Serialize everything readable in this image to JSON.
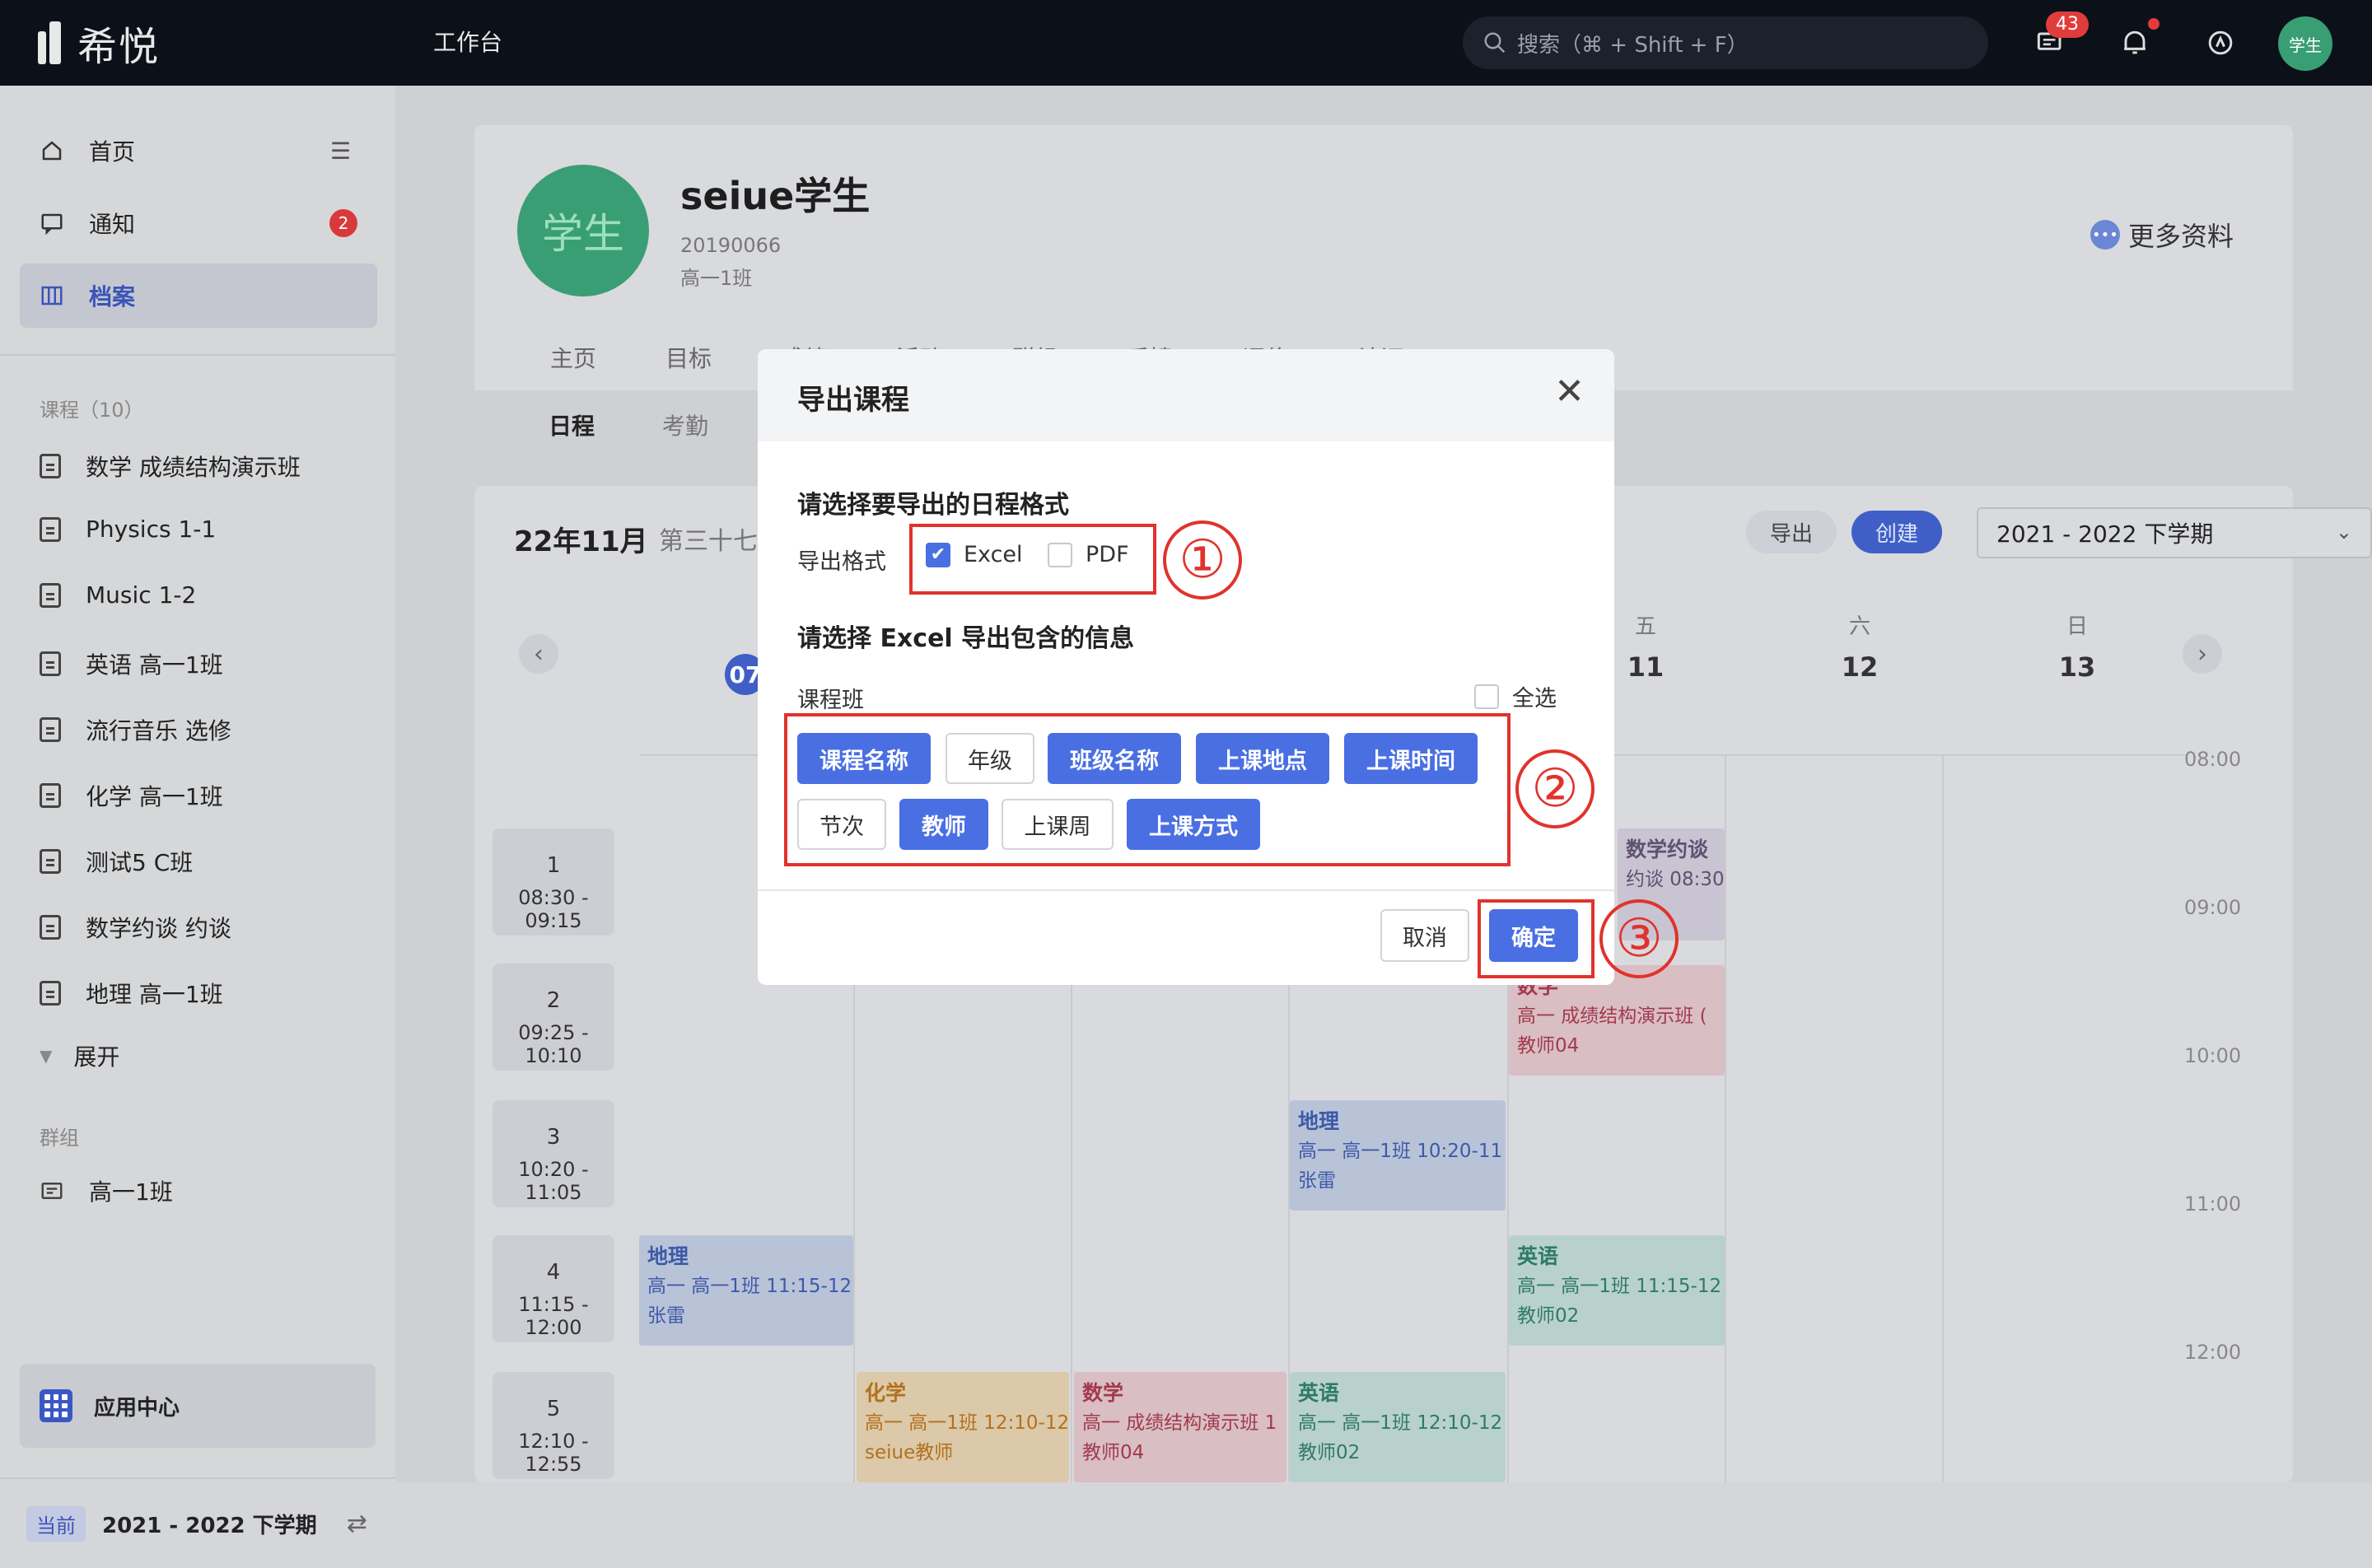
{
  "topbar": {
    "logo_text": "希悦",
    "workbench": "工作台",
    "search_placeholder": "搜索（⌘ + Shift + F）",
    "message_count": "43",
    "avatar_text": "学生"
  },
  "sidebar": {
    "nav": [
      {
        "label": "首页",
        "icon": "home-icon"
      },
      {
        "label": "通知",
        "icon": "message-icon",
        "badge": "2"
      },
      {
        "label": "档案",
        "icon": "archive-icon",
        "active": true
      }
    ],
    "courses_title": "课程（10）",
    "courses": [
      "数学 成绩结构演示班",
      "Physics 1-1",
      "Music 1-2",
      "英语 高一1班",
      "流行音乐 选修",
      "化学 高一1班",
      "测试5 C班",
      "数学约谈 约谈",
      "地理 高一1班"
    ],
    "expand_label": "展开",
    "groups_title": "群组",
    "groups": [
      "高一1班"
    ],
    "app_center": "应用中心",
    "term_tag": "当前",
    "term": "2021 - 2022 下学期"
  },
  "profile": {
    "avatar_text": "学生",
    "name": "seiue学生",
    "id": "20190066",
    "class": "高一1班",
    "more_info": "更多资料",
    "tabs": [
      "主页",
      "目标",
      "成绩",
      "活动",
      "群组",
      "反馈",
      "评价",
      "认证"
    ],
    "subtabs": [
      "日程",
      "考勤"
    ]
  },
  "calendar": {
    "month": "22年11月",
    "week": "第三十七",
    "export": "导出",
    "create": "创建",
    "term_select": "2021 - 2022 下学期",
    "today": "07",
    "days": [
      {
        "wd": "五",
        "dn": "11"
      },
      {
        "wd": "六",
        "dn": "12"
      },
      {
        "wd": "日",
        "dn": "13"
      }
    ],
    "periods": [
      {
        "n": "1",
        "t": "08:30 - 09:15"
      },
      {
        "n": "2",
        "t": "09:25 - 10:10"
      },
      {
        "n": "3",
        "t": "10:20 - 11:05"
      },
      {
        "n": "4",
        "t": "11:15 - 12:00"
      },
      {
        "n": "5",
        "t": "12:10 - 12:55"
      }
    ],
    "times": [
      "08:00",
      "09:00",
      "10:00",
      "11:00",
      "12:00"
    ],
    "events": [
      {
        "title": "数学约谈",
        "l1": "约谈  08:30",
        "l2": ""
      },
      {
        "title": "数学",
        "l1": "高一  成绩结构演示班  (",
        "l2": "教师04"
      },
      {
        "title": "地理",
        "l1": "高一  高一1班  10:20-11",
        "l2": "张雷"
      },
      {
        "title": "地理",
        "l1": "高一  高一1班  11:15-12",
        "l2": "张雷"
      },
      {
        "title": "英语",
        "l1": "高一  高一1班  11:15-12",
        "l2": "教师02"
      },
      {
        "title": "化学",
        "l1": "高一  高一1班  12:10-12",
        "l2": "seiue教师"
      },
      {
        "title": "数学",
        "l1": "高一  成绩结构演示班  1",
        "l2": "教师04"
      },
      {
        "title": "英语",
        "l1": "高一  高一1班  12:10-12",
        "l2": "教师02"
      }
    ]
  },
  "modal": {
    "title": "导出课程",
    "q1": "请选择要导出的日程格式",
    "format_label": "导出格式",
    "formats": [
      {
        "label": "Excel",
        "checked": true
      },
      {
        "label": "PDF",
        "checked": false
      }
    ],
    "q2": "请选择 Excel 导出包含的信息",
    "class_label": "课程班",
    "select_all": "全选",
    "tags": [
      {
        "label": "课程名称",
        "selected": true
      },
      {
        "label": "年级",
        "selected": false
      },
      {
        "label": "班级名称",
        "selected": true
      },
      {
        "label": "上课地点",
        "selected": true
      },
      {
        "label": "上课时间",
        "selected": true
      },
      {
        "label": "节次",
        "selected": false
      },
      {
        "label": "教师",
        "selected": true
      },
      {
        "label": "上课周",
        "selected": false
      },
      {
        "label": "上课方式",
        "selected": true
      }
    ],
    "cancel": "取消",
    "ok": "确定"
  },
  "annotations": [
    "①",
    "②",
    "③"
  ],
  "colors": {
    "accent": "#4a6fe3",
    "annotation": "#e0332c",
    "topbar": "#0c1018"
  }
}
